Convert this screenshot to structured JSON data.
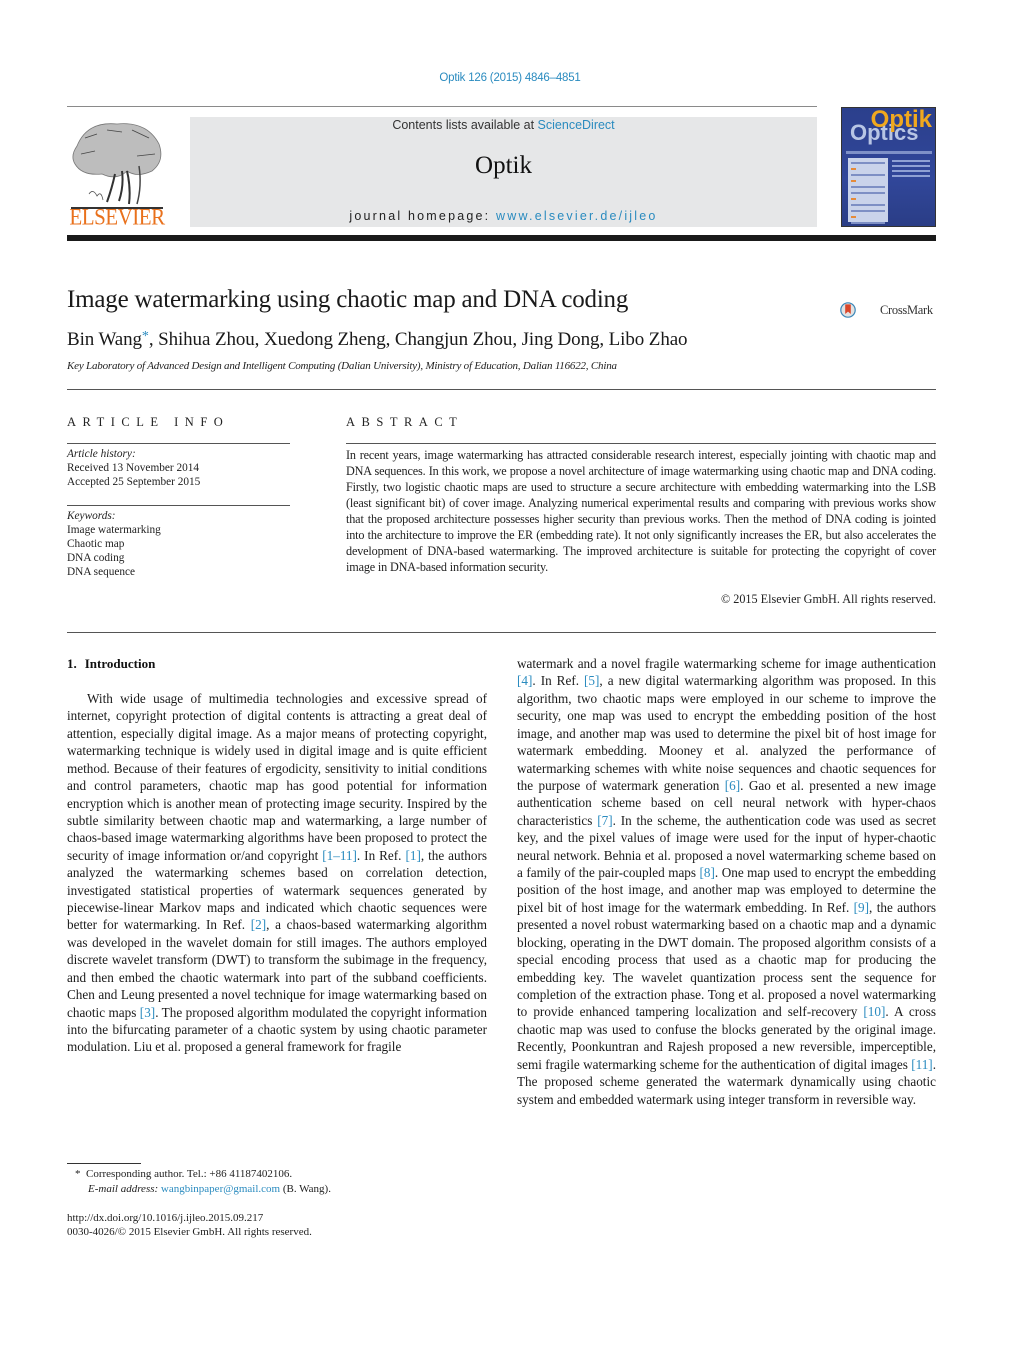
{
  "header": {
    "citation": "Optik 126 (2015) 4846–4851",
    "contents_prefix": "Contents lists available at ",
    "contents_link": "ScienceDirect",
    "journal_title": "Optik",
    "homepage_prefix": "journal homepage: ",
    "homepage_link": "www.elsevier.de/ijleo",
    "publisher_logo_text": "ELSEVIER",
    "cover_title_top": "Optik",
    "cover_title_bottom": "Optics",
    "crossmark_label": "CrossMark",
    "colors": {
      "link": "#2a8bbf",
      "elsevier_orange": "#e9711c",
      "band_gray": "#e6e7e8",
      "cover_blue": "#2b3f8c"
    }
  },
  "article": {
    "title": "Image watermarking using chaotic map and DNA coding",
    "first_author": "Bin Wang",
    "corresponding_marker": "*",
    "other_authors": ", Shihua Zhou, Xuedong Zheng, Changjun Zhou, Jing Dong, Libo Zhao",
    "affiliation": "Key Laboratory of Advanced Design and Intelligent Computing (Dalian University), Ministry of Education, Dalian 116622, China"
  },
  "article_info": {
    "heading": "ARTICLE INFO",
    "history_label": "Article history:",
    "received": "Received 13 November 2014",
    "accepted": "Accepted 25 September 2015",
    "keywords_label": "Keywords:",
    "keywords": [
      "Image watermarking",
      "Chaotic map",
      "DNA coding",
      "DNA sequence"
    ]
  },
  "abstract": {
    "heading": "ABSTRACT",
    "text": "In recent years, image watermarking has attracted considerable research interest, especially jointing with chaotic map and DNA sequences. In this work, we propose a novel architecture of image watermarking using chaotic map and DNA coding. Firstly, two logistic chaotic maps are used to structure a secure architecture with embedding watermarking into the LSB (least significant bit) of cover image. Analyzing numerical experimental results and comparing with previous works show that the proposed architecture possesses higher security than previous works. Then the method of DNA coding is jointed into the architecture to improve the ER (embedding rate). It not only significantly increases the ER, but also accelerates the development of DNA-based watermarking. The improved architecture is suitable for protecting the copyright of cover image in DNA-based information security.",
    "copyright": "© 2015 Elsevier GmbH. All rights reserved."
  },
  "section1": {
    "number": "1.",
    "title": "Introduction",
    "left_segments": [
      "With wide usage of multimedia technologies and excessive spread of internet, copyright protection of digital contents is attracting a great deal of attention, especially digital image. As a major means of protecting copyright, watermarking technique is widely used in digital image and is quite efficient method. Because of their features of ergodicity, sensitivity to initial conditions and control parameters, chaotic map has good potential for information encryption which is another mean of protecting image security. Inspired by the subtle similarity between chaotic map and watermarking, a large number of chaos-based image watermarking algorithms have been proposed to protect the security of image information or/and copyright ",
      "[1–11]",
      ". In Ref. ",
      "[1]",
      ", the authors analyzed the watermarking schemes based on correlation detection, investigated statistical properties of watermark sequences generated by piecewise-linear Markov maps and indicated which chaotic sequences were better for watermarking. In Ref. ",
      "[2]",
      ", a chaos-based watermarking algorithm was developed in the wavelet domain for still images. The authors employed discrete wavelet transform (DWT) to transform the subimage in the frequency, and then embed the chaotic watermark into part of the subband coefficients. Chen and Leung presented a novel technique for image watermarking based on chaotic maps ",
      "[3]",
      ". The proposed algorithm modulated the copyright information into the bifurcating parameter of a chaotic system by using chaotic parameter modulation. Liu et al. proposed a general framework for fragile"
    ],
    "right_segments": [
      "watermark and a novel fragile watermarking scheme for image authentication ",
      "[4]",
      ". In Ref. ",
      "[5]",
      ", a new digital watermarking algorithm was proposed. In this algorithm, two chaotic maps were employed in our scheme to improve the security, one map was used to encrypt the embedding position of the host image, and another map was used to determine the pixel bit of host image for watermark embedding. Mooney et al. analyzed the performance of watermarking schemes with white noise sequences and chaotic sequences for the purpose of watermark generation ",
      "[6]",
      ". Gao et al. presented a new image authentication scheme based on cell neural network with hyper-chaos characteristics ",
      "[7]",
      ". In the scheme, the authentication code was used as secret key, and the pixel values of image were used for the input of hyper-chaotic neural network. Behnia et al. proposed a novel watermarking scheme based on a family of the pair-coupled maps ",
      "[8]",
      ". One map used to encrypt the embedding position of the host image, and another map was employed to determine the pixel bit of host image for the watermark embedding. In Ref. ",
      "[9]",
      ", the authors presented a novel robust watermarking based on a chaotic map and a dynamic blocking, operating in the DWT domain. The proposed algorithm consists of a special encoding process that used as a chaotic map for producing the embedding key. The wavelet quantization process sent the sequence for completion of the extraction phase. Tong et al. proposed a novel watermarking to provide enhanced tampering localization and self-recovery ",
      "[10]",
      ". A cross chaotic map was used to confuse the blocks generated by the original image. Recently, Poonkuntran and Rajesh proposed a new reversible, imperceptible, semi fragile watermarking scheme for the authentication of digital images ",
      "[11]",
      ". The proposed scheme generated the watermark dynamically using chaotic system and embedded watermark using integer transform in reversible way."
    ]
  },
  "footnotes": {
    "marker": "*",
    "corresponding": "Corresponding author. Tel.: +86 41187402106.",
    "email_label": "E-mail address: ",
    "email": "wangbinpaper@gmail.com",
    "email_suffix": " (B. Wang).",
    "doi": "http://dx.doi.org/10.1016/j.ijleo.2015.09.217",
    "issn_copyright": "0030-4026/© 2015 Elsevier GmbH. All rights reserved."
  }
}
